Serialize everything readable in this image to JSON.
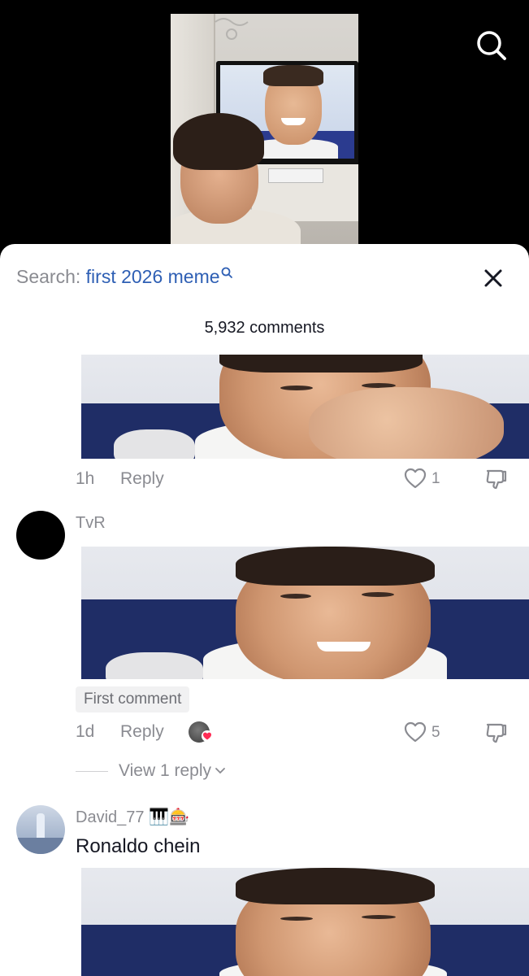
{
  "search": {
    "label": "Search: ",
    "query": "first 2026 meme"
  },
  "comments_count": "5,932 comments",
  "comments": [
    {
      "time": "1h",
      "reply_label": "Reply",
      "likes": "1"
    },
    {
      "username": "TvR",
      "tag": "First comment",
      "time": "1d",
      "reply_label": "Reply",
      "likes": "5",
      "view_replies": "View 1 reply"
    },
    {
      "username": "David_77",
      "username_emojis": "🎹🎰",
      "text": "Ronaldo chein"
    }
  ],
  "icons": {
    "top_right": "search-icon",
    "close": "close-icon",
    "like": "heart-outline-icon",
    "dislike": "thumbs-down-icon"
  },
  "colors": {
    "query_link": "#2e5fb4",
    "muted_text": "#8a8b91",
    "heart_badge": "#fe2c55"
  }
}
